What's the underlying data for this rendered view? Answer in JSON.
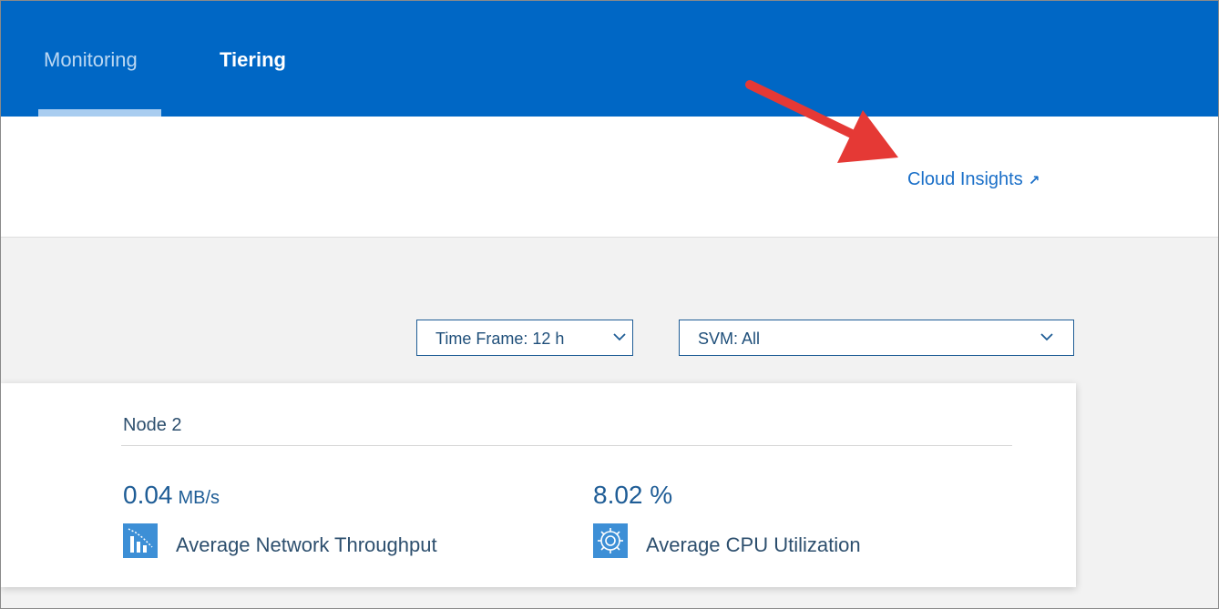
{
  "tabs": {
    "monitoring": "Monitoring",
    "tiering": "Tiering"
  },
  "link": {
    "label": "Cloud Insights",
    "icon": "external-link-arrow-icon",
    "glyph": "↗"
  },
  "filters": {
    "time_frame": "Time Frame: 12 h",
    "svm": "SVM: All"
  },
  "node": {
    "title": "Node 2",
    "network": {
      "value": "0.04",
      "unit": "MB/s",
      "label": "Average Network Throughput",
      "icon": "bar-chart-icon"
    },
    "cpu": {
      "value": "8.02 %",
      "label": "Average CPU Utilization",
      "icon": "gear-icon"
    }
  },
  "colors": {
    "topbar": "#0067c5",
    "accent": "#1a6fc8",
    "annotation_arrow": "#e53935"
  }
}
